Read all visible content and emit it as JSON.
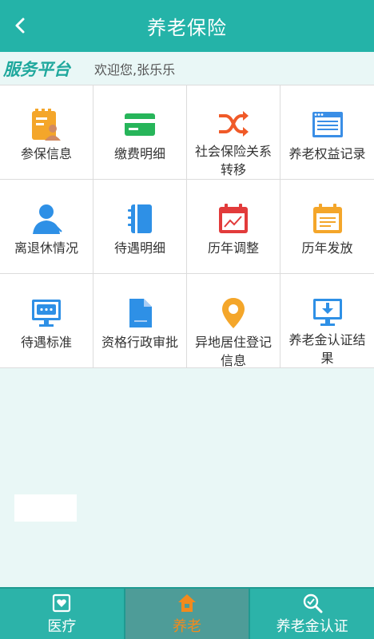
{
  "header": {
    "title": "养老保险",
    "back_icon": "chevron-left-icon"
  },
  "welcome": {
    "brand": "服务平台",
    "greeting": "欢迎您,张乐乐"
  },
  "grid_items": [
    {
      "label": "参保信息",
      "icon": "insured-person-icon",
      "color": "#f4a62a"
    },
    {
      "label": "缴费明细",
      "icon": "card-icon",
      "color": "#27b55a"
    },
    {
      "label": "社会保险关系转移",
      "icon": "shuffle-icon",
      "color": "#f05a28"
    },
    {
      "label": "养老权益记录",
      "icon": "browser-window-icon",
      "color": "#3a8ee6"
    },
    {
      "label": "离退休情况",
      "icon": "person-icon",
      "color": "#2e90e6"
    },
    {
      "label": "待遇明细",
      "icon": "notebook-icon",
      "color": "#2e90e6"
    },
    {
      "label": "历年调整",
      "icon": "calendar-chart-icon",
      "color": "#e23b3b"
    },
    {
      "label": "历年发放",
      "icon": "calendar-list-icon",
      "color": "#f4a62a"
    },
    {
      "label": "待遇标准",
      "icon": "monitor-chat-icon",
      "color": "#2e90e6"
    },
    {
      "label": "资格行政审批",
      "icon": "document-icon",
      "color": "#2e90e6"
    },
    {
      "label": "异地居住登记信息",
      "icon": "location-pin-icon",
      "color": "#f4a62a"
    },
    {
      "label": "养老金认证结果",
      "icon": "monitor-download-icon",
      "color": "#2e90e6"
    }
  ],
  "bottom_nav": [
    {
      "label": "医疗",
      "icon": "heart-card-icon"
    },
    {
      "label": "养老",
      "icon": "house-icon"
    },
    {
      "label": "养老金认证",
      "icon": "magnifier-check-icon"
    }
  ],
  "colors": {
    "primary": "#24b3a8",
    "active_nav": "#f28a1d"
  }
}
